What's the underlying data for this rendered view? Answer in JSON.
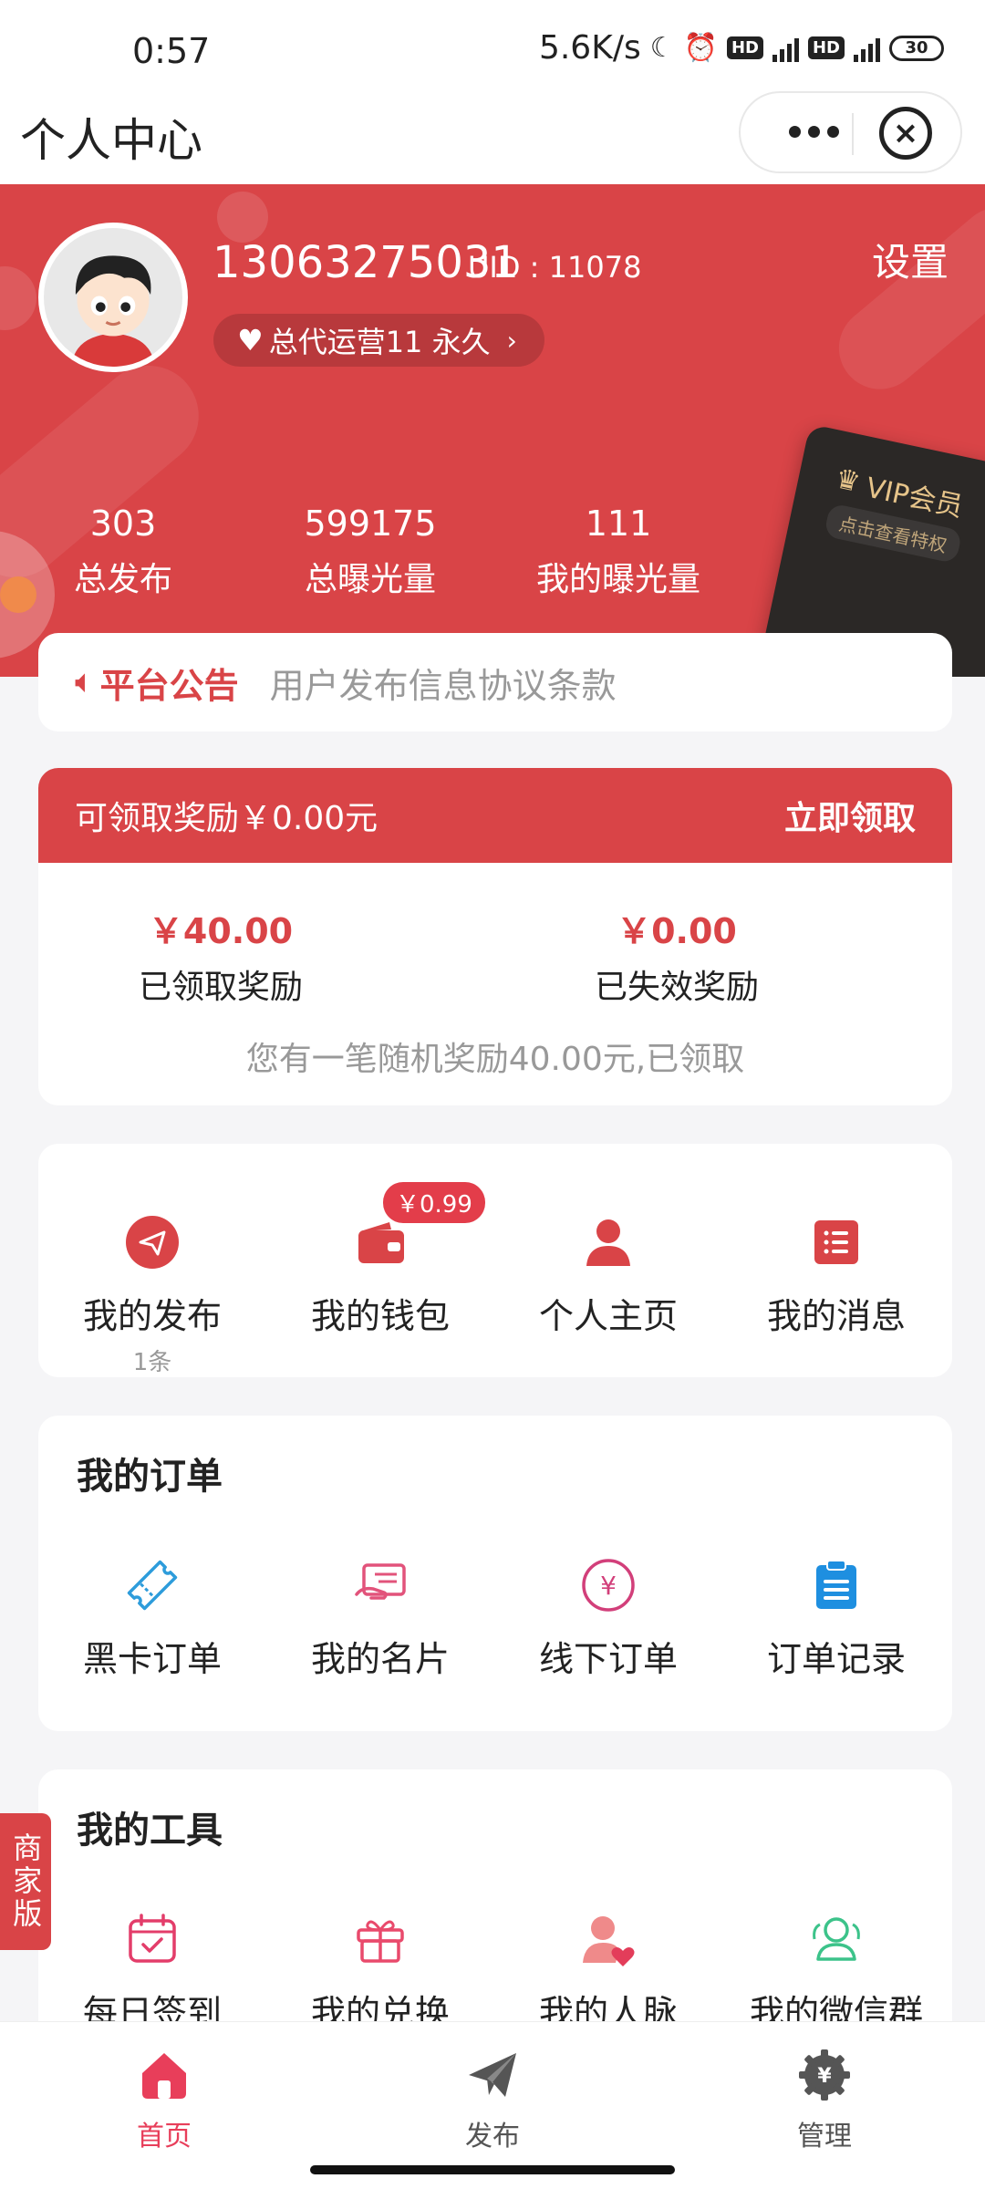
{
  "status_bar": {
    "time": "0:57",
    "speed": "5.6K/s",
    "battery": "30"
  },
  "title_bar": {
    "title": "个人中心"
  },
  "profile": {
    "phone": "13063275031",
    "uid": "UID : 11078",
    "level": "总代运营11 永久",
    "settings_label": "设置"
  },
  "stats": [
    {
      "value": "303",
      "label": "总发布"
    },
    {
      "value": "599175",
      "label": "总曝光量"
    },
    {
      "value": "111",
      "label": "我的曝光量"
    }
  ],
  "vip": {
    "title": "VIP会员",
    "subtitle": "点击查看特权"
  },
  "notice": {
    "label": "平台公告",
    "text": "用户发布信息协议条款"
  },
  "reward": {
    "claimable": "可领取奖励￥0.00元",
    "claim_button": "立即领取",
    "claimed_amount": "￥40.00",
    "claimed_label": "已领取奖励",
    "expired_amount": "￥0.00",
    "expired_label": "已失效奖励",
    "note": "您有一笔随机奖励40.00元,已领取"
  },
  "quick_links": [
    {
      "label": "我的发布",
      "sub": "1条",
      "icon": "paper-plane-icon"
    },
    {
      "label": "我的钱包",
      "badge": "￥0.99",
      "icon": "wallet-icon"
    },
    {
      "label": "个人主页",
      "icon": "person-icon"
    },
    {
      "label": "我的消息",
      "icon": "message-list-icon"
    }
  ],
  "orders": {
    "title": "我的订单",
    "items": [
      {
        "label": "黑卡订单",
        "icon": "ticket-icon"
      },
      {
        "label": "我的名片",
        "icon": "business-card-icon"
      },
      {
        "label": "线下订单",
        "icon": "yuan-circle-icon"
      },
      {
        "label": "订单记录",
        "icon": "clipboard-icon"
      }
    ]
  },
  "tools": {
    "title": "我的工具",
    "items": [
      {
        "label": "每日签到",
        "icon": "calendar-check-icon"
      },
      {
        "label": "我的兑换",
        "icon": "gift-icon"
      },
      {
        "label": "我的人脉",
        "icon": "contacts-heart-icon"
      },
      {
        "label": "我的微信群",
        "icon": "group-icon"
      }
    ]
  },
  "side_tab": {
    "label": "商家版"
  },
  "tabbar": [
    {
      "label": "首页",
      "icon": "home-icon",
      "active": true
    },
    {
      "label": "发布",
      "icon": "send-icon"
    },
    {
      "label": "管理",
      "icon": "gear-yuan-icon"
    }
  ],
  "colors": {
    "brand_red": "#d94447",
    "tab_active": "#e83e5a",
    "vip_gold": "#e6c48a"
  }
}
